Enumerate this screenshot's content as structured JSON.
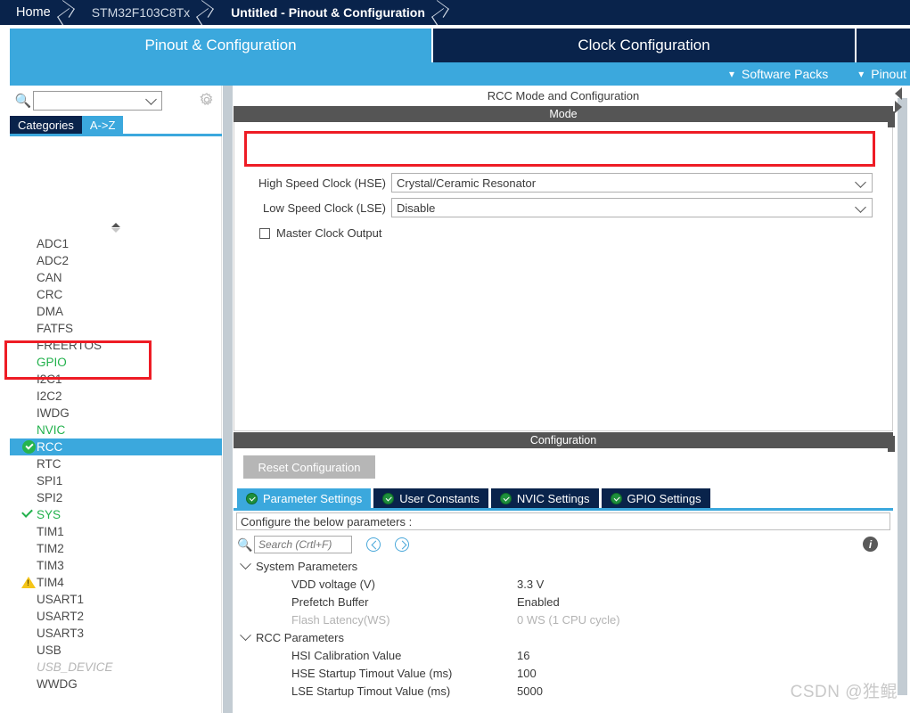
{
  "breadcrumb": {
    "items": [
      {
        "label": "Home",
        "active": false
      },
      {
        "label": "STM32F103C8Tx",
        "active": false
      },
      {
        "label": "Untitled - Pinout & Configuration",
        "active": true
      }
    ]
  },
  "main_tabs": [
    {
      "label": "Pinout & Configuration",
      "selected": true
    },
    {
      "label": "Clock Configuration",
      "selected": false
    }
  ],
  "subbar": {
    "software_packs": "Software Packs",
    "pinout": "Pinout"
  },
  "sidebar": {
    "search": {
      "value": "",
      "placeholder": ""
    },
    "category_tabs": [
      {
        "label": "Categories",
        "selected": false
      },
      {
        "label": "A->Z",
        "selected": true
      }
    ],
    "peripherals": [
      {
        "label": "ADC1",
        "state": "normal"
      },
      {
        "label": "ADC2",
        "state": "normal"
      },
      {
        "label": "CAN",
        "state": "normal"
      },
      {
        "label": "CRC",
        "state": "normal"
      },
      {
        "label": "DMA",
        "state": "normal"
      },
      {
        "label": "FATFS",
        "state": "normal"
      },
      {
        "label": "FREERTOS",
        "state": "normal"
      },
      {
        "label": "GPIO",
        "state": "green"
      },
      {
        "label": "I2C1",
        "state": "normal"
      },
      {
        "label": "I2C2",
        "state": "normal"
      },
      {
        "label": "IWDG",
        "state": "normal"
      },
      {
        "label": "NVIC",
        "state": "green"
      },
      {
        "label": "RCC",
        "state": "selected"
      },
      {
        "label": "RTC",
        "state": "normal"
      },
      {
        "label": "SPI1",
        "state": "normal"
      },
      {
        "label": "SPI2",
        "state": "normal"
      },
      {
        "label": "SYS",
        "state": "green-check"
      },
      {
        "label": "TIM1",
        "state": "normal"
      },
      {
        "label": "TIM2",
        "state": "normal"
      },
      {
        "label": "TIM3",
        "state": "normal"
      },
      {
        "label": "TIM4",
        "state": "warning"
      },
      {
        "label": "USART1",
        "state": "normal"
      },
      {
        "label": "USART2",
        "state": "normal"
      },
      {
        "label": "USART3",
        "state": "normal"
      },
      {
        "label": "USB",
        "state": "normal"
      },
      {
        "label": "USB_DEVICE",
        "state": "disabled"
      },
      {
        "label": "WWDG",
        "state": "normal"
      }
    ]
  },
  "main": {
    "panel_title": "RCC Mode and Configuration",
    "mode": {
      "header": "Mode",
      "hse_label": "High Speed Clock (HSE)",
      "hse_value": "Crystal/Ceramic Resonator",
      "lse_label": "Low Speed Clock (LSE)",
      "lse_value": "Disable",
      "mco_label": "Master Clock Output",
      "mco_checked": false
    },
    "configuration": {
      "header": "Configuration",
      "reset_button": "Reset Configuration",
      "tabs": [
        {
          "label": "Parameter Settings",
          "selected": true
        },
        {
          "label": "User Constants",
          "selected": false
        },
        {
          "label": "NVIC Settings",
          "selected": false
        },
        {
          "label": "GPIO Settings",
          "selected": false
        }
      ],
      "note": "Configure the below parameters :",
      "search_placeholder": "Search (Crtl+F)",
      "groups": [
        {
          "name": "System Parameters",
          "items": [
            {
              "name": "VDD voltage (V)",
              "value": "3.3 V",
              "disabled": false
            },
            {
              "name": "Prefetch Buffer",
              "value": "Enabled",
              "disabled": false
            },
            {
              "name": "Flash Latency(WS)",
              "value": "0 WS (1 CPU cycle)",
              "disabled": true
            }
          ]
        },
        {
          "name": "RCC Parameters",
          "items": [
            {
              "name": "HSI Calibration Value",
              "value": "16",
              "disabled": false
            },
            {
              "name": "HSE Startup Timout Value (ms)",
              "value": "100",
              "disabled": false
            },
            {
              "name": "LSE Startup Timout Value (ms)",
              "value": "5000",
              "disabled": false
            }
          ]
        }
      ]
    }
  },
  "watermark": "CSDN @狌鲲",
  "colors": {
    "navy": "#09234b",
    "accent_blue": "#3ba8dd",
    "section_gray": "#555555",
    "highlight_red": "#ee1c25",
    "green": "#22b14c",
    "warning_yellow": "#f5c518"
  }
}
